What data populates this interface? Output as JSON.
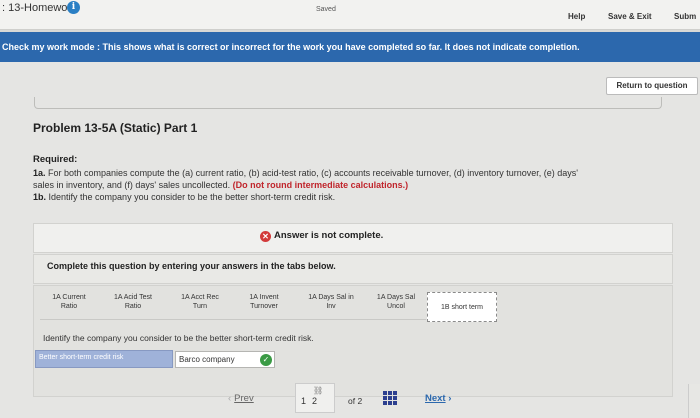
{
  "topbar": {
    "title": ": 13-Homework",
    "saved": "Saved",
    "help": "Help",
    "save_exit": "Save & Exit",
    "submit": "Subm"
  },
  "banner": {
    "text": "Check my work mode : This shows what is correct or incorrect for the work you have completed so far. It does not indicate completion."
  },
  "return_button": "Return to question",
  "problem": {
    "title": "Problem 13-5A (Static) Part 1",
    "required_label": "Required:",
    "line1_prefix": "1a.",
    "line1": " For both companies compute the (a) current ratio, (b) acid-test ratio, (c) accounts receivable turnover, (d) inventory turnover, (e) days'",
    "line2": "sales in inventory, and (f) days' sales uncollected. ",
    "line2_red": "(Do not round intermediate calculations.)",
    "line3_prefix": "1b.",
    "line3": " Identify the company you consider to be the better short-term credit risk."
  },
  "answer_status": "Answer is not complete.",
  "instructions": "Complete this question by entering your answers in the tabs below.",
  "tabs": [
    {
      "line1": "1A Current",
      "line2": "Ratio"
    },
    {
      "line1": "1A Acid Test",
      "line2": "Ratio"
    },
    {
      "line1": "1A Acct Rec",
      "line2": "Turn"
    },
    {
      "line1": "1A Invent",
      "line2": "Turnover"
    },
    {
      "line1": "1A Days Sal in",
      "line2": "Inv"
    },
    {
      "line1": "1A Days Sal",
      "line2": "Uncol"
    },
    {
      "line1": "1B short term",
      "line2": ""
    }
  ],
  "question": {
    "prompt": "Identify the company you consider to be the better short-term credit risk.",
    "label": "Better short-term credit risk",
    "value": "Barco company"
  },
  "pager": {
    "prev": "Prev",
    "current": "1",
    "page": "2",
    "of_label": "of 2",
    "next": "Next"
  },
  "colors": {
    "banner": "#2c68ad",
    "error": "#d23a3a",
    "correct": "#3a9a44",
    "answer_label": "#9fb2d9"
  }
}
